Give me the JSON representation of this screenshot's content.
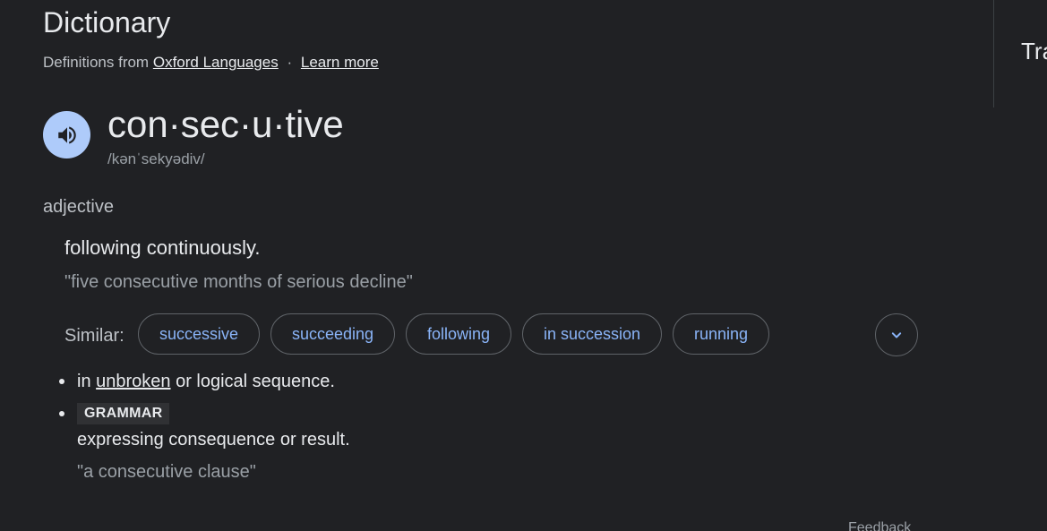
{
  "header": {
    "title": "Dictionary",
    "source_prefix": "Definitions from",
    "source_link": "Oxford Languages",
    "separator": "·",
    "learn_more": "Learn more"
  },
  "side_panel": {
    "peek_text": "Tra"
  },
  "entry": {
    "headword": "con·sec·u·tive",
    "phonetic": "/kənˈsekyədiv/",
    "pronounce_icon": "speaker-icon",
    "part_of_speech": "adjective",
    "definition_1": "following continuously.",
    "example_1": "\"five consecutive months of serious decline\"",
    "similar_label": "Similar:",
    "similar": [
      "successive",
      "succeeding",
      "following",
      "in succession",
      "running"
    ],
    "expand_icon": "chevron-down-icon",
    "sense_1": {
      "prefix": "in ",
      "link": "unbroken",
      "suffix": " or logical sequence."
    },
    "sense_2": {
      "label": "GRAMMAR",
      "definition": "expressing consequence or result.",
      "example": "\"a consecutive clause\""
    }
  },
  "footer": {
    "feedback": "Feedback"
  },
  "colors": {
    "background": "#202124",
    "text": "#e8eaed",
    "muted": "#9aa0a6",
    "link_blue": "#8ab4f8",
    "speaker_bg": "#aecbfa"
  }
}
